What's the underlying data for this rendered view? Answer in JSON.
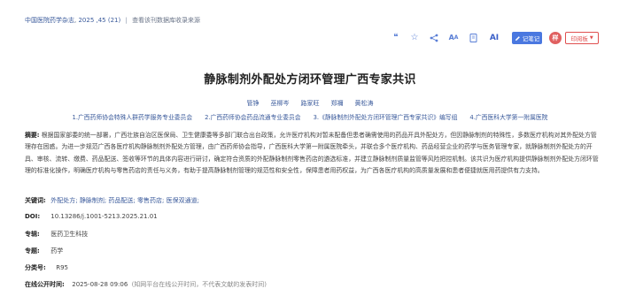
{
  "breadcrumb": {
    "journal": "中国医院药学杂志",
    "issue": "2025 ,45 (21)",
    "separator": "|",
    "database": "查看该刊数据库收录来源"
  },
  "toolbar": {
    "icons": [
      "quote-icon",
      "star-icon",
      "share-icon",
      "font-size-icon",
      "bookmark-icon",
      "ai-icon"
    ],
    "ai_label": "AI",
    "note_label": "记笔记",
    "avatar_label": "样",
    "print_label": "印阅板"
  },
  "article": {
    "title": "静脉制剂外配处方闭环管理广西专家共识",
    "authors": [
      "管铮",
      "巫柳岑",
      "路家旺",
      "郑禰",
      "黄松涛"
    ],
    "affiliations": [
      "1.广西药师协会特殊人群药学服务专业委员会",
      "2.广西药师协会药品流通专业委员会",
      "3.《静脉制剂外配处方闭环管理广西专家共识》编写组",
      "4.广西医科大学第一附属医院"
    ],
    "abstract_label": "摘要:",
    "abstract": "根据国家部委的统一部署，广西壮族自治区医保局、卫生健康委等多部门联合出台政策，允许医疗机构对暂未配备但患者确需使用的药品开具外配处方，但因静脉制剂的特殊性，多数医疗机构对其外配处方管理存在困惑。为进一步规范广西各医疗机构静脉制剂外配处方管理，由广西药师协会指导，广西医科大学第一附属医院牵头，并联合多个医疗机构、药品经营企业的药学与医务管理专家，就静脉制剂外配处方的开具、审核、流转、缴费、药品配送、签收等环节的具体内容进行研讨，确定符合资质的外配静脉制剂零售药店的遴选标准，并建立静脉制剂质量监管等风险把控机制。该共识为医疗机构提供静脉制剂外配处方闭环管理的标准化操作，明确医疗机构与零售药店的责任与义务，有助于提高静脉制剂管理的规范性和安全性，保障患者用药权益，为广西各医疗机构的高质量发展和患者便捷就医用药提供有力支持。",
    "keywords_label": "关键词:",
    "keywords": [
      "外配处方;",
      "静脉制剂;",
      "药品配送;",
      "零售药店;",
      "医保双通道;"
    ],
    "doi_label": "DOI:",
    "doi": "10.13286/j.1001-5213.2025.21.01",
    "series_label": "专辑:",
    "series": "医药卫生科技",
    "topic_label": "专题:",
    "topic": "药学",
    "class_label": "分类号:",
    "class_no": "R95",
    "pub_label": "在线公开时间:",
    "pub_time": "2025-08-28 09:06",
    "pub_note": "(知网平台在线公开时间，不代表文献的发表时间)"
  }
}
